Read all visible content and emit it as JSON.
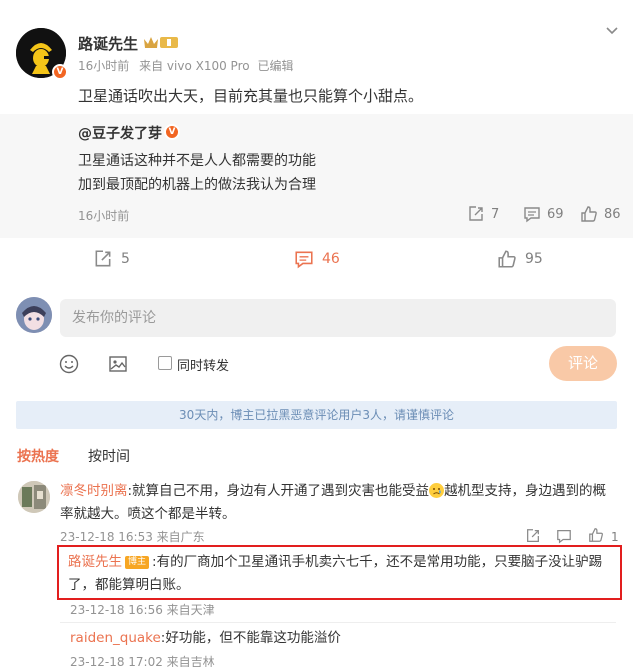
{
  "post": {
    "author": "路诞先生",
    "time": "16小时前",
    "source": "来自 vivo X100 Pro",
    "edited": "已编辑",
    "text": "卫星通话吹出大天，目前充其量也只能算个小甜点。"
  },
  "repost": {
    "author": "@豆子发了芽",
    "lines": [
      "卫星通话这种并不是人人都需要的功能",
      "加到最顶配的机器上的做法我认为合理"
    ],
    "time": "16小时前",
    "shares": "7",
    "comments": "69",
    "likes": "86"
  },
  "actions": {
    "shares": "5",
    "comments": "46",
    "likes": "95"
  },
  "composer": {
    "placeholder": "发布你的评论",
    "also_repost": "同时转发",
    "submit": "评论"
  },
  "notice": "30天内，博主已拉黑恶意评论用户3人，请谨慎评论",
  "sort": {
    "hot": "按热度",
    "time": "按时间"
  },
  "comments": [
    {
      "user": "凛冬时别离",
      "text_a": ":就算自己不用，身边有人开通了遇到灾害也能受益",
      "text_b": "越机型支持，身边遇到的概率就越大。喷这个都是半转。",
      "time": "23-12-18 16:53 来自广东",
      "reply": {
        "user": "路诞先生",
        "tag": "博主",
        "text": ":有的厂商加个卫星通讯手机卖六七千，还不是常用功能，只要脑子没让驴踢了，都能算明白账。",
        "time": "23-12-18 16:56 来自天津"
      },
      "reply2": {
        "user": "raiden_quake",
        "text": ":好功能，但不能靠这功能溢价",
        "time": "23-12-18 17:02 来自吉林"
      }
    }
  ],
  "colors": {
    "accent": "#eb7350",
    "highlight_border": "#e21e1e",
    "notice_bg": "#e6eef8"
  }
}
